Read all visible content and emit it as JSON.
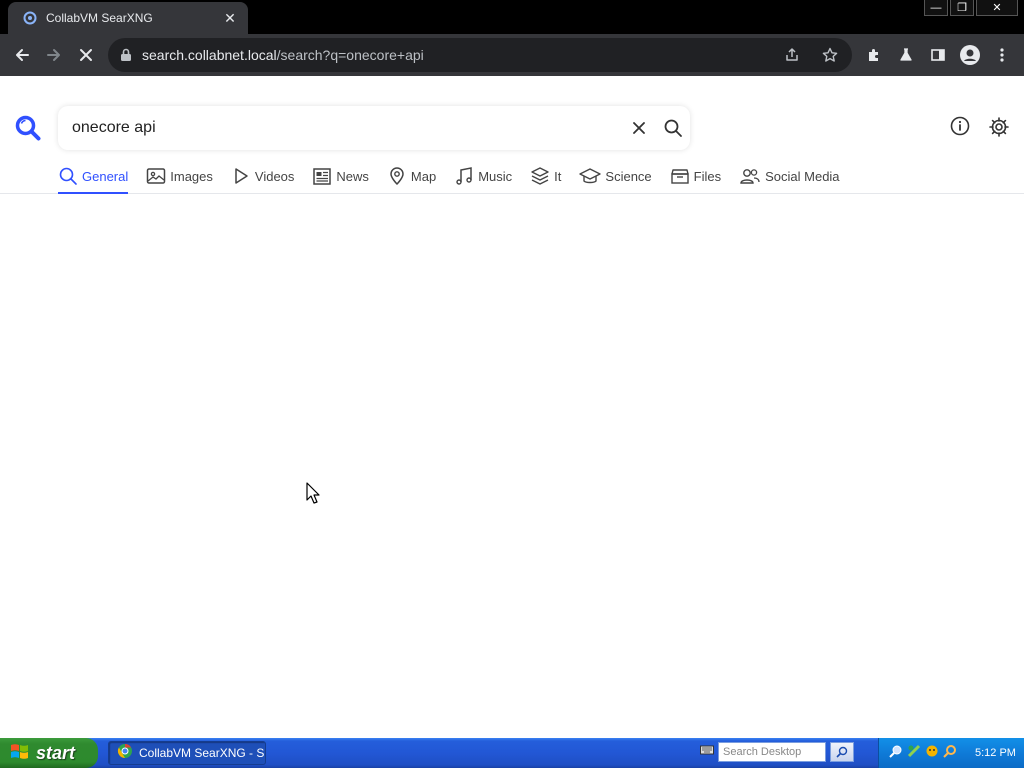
{
  "browser": {
    "tab": {
      "title": "CollabVM SearXNG",
      "close_glyph": "✕"
    },
    "window_controls": {
      "minimize": "—",
      "restore": "❐",
      "close": "✕"
    },
    "toolbar": {
      "url_host": "search.collabnet.local",
      "url_path": "/search?q=onecore+api",
      "icons": [
        "back-arrow-icon",
        "forward-arrow-icon",
        "stop-loading-icon",
        "lock-icon",
        "share-icon",
        "bookmark-star-icon",
        "extensions-puzzle-icon",
        "labs-flask-icon",
        "side-panel-icon",
        "profile-avatar-icon",
        "kebab-menu-icon"
      ]
    }
  },
  "search": {
    "query": "onecore api",
    "accent_color": "#3050ff",
    "categories": [
      {
        "label": "General",
        "icon": "magnifier-icon",
        "active": true
      },
      {
        "label": "Images",
        "icon": "image-icon",
        "active": false
      },
      {
        "label": "Videos",
        "icon": "play-icon",
        "active": false
      },
      {
        "label": "News",
        "icon": "newspaper-icon",
        "active": false
      },
      {
        "label": "Map",
        "icon": "map-pin-icon",
        "active": false
      },
      {
        "label": "Music",
        "icon": "music-note-icon",
        "active": false
      },
      {
        "label": "It",
        "icon": "layers-icon",
        "active": false
      },
      {
        "label": "Science",
        "icon": "graduation-cap-icon",
        "active": false
      },
      {
        "label": "Files",
        "icon": "archive-icon",
        "active": false
      },
      {
        "label": "Social Media",
        "icon": "people-icon",
        "active": false
      }
    ]
  },
  "taskbar": {
    "start_label": "start",
    "task_label": "CollabVM SearXNG - S...",
    "search_placeholder": "Search Desktop",
    "clock": "5:12 PM"
  }
}
